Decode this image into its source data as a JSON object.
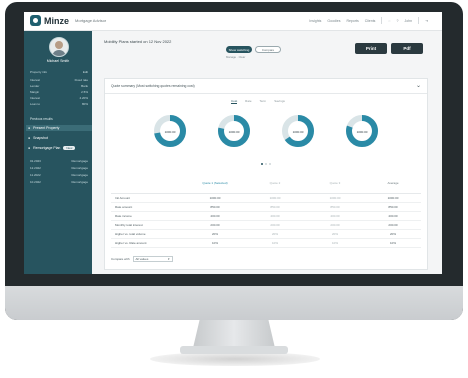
{
  "app": {
    "logo_text": "Minze",
    "logo_sub": "Mortgage Advisor",
    "nav": [
      "Insights",
      "Goodies",
      "Reports",
      "Clients",
      "John"
    ]
  },
  "sidebar": {
    "client_name": "Michael Smith",
    "section1_head": "Property info",
    "section1_value": "Edit",
    "details": [
      {
        "label": "Interest",
        "value": "Fixed rate"
      },
      {
        "label": "Lender",
        "value": "Bank"
      },
      {
        "label": "Margin",
        "value": "2.5%"
      },
      {
        "label": "Interest",
        "value": "4.20%"
      },
      {
        "label": "Loan to",
        "value": "80%"
      }
    ],
    "section2_head": "Previous results",
    "items": [
      {
        "label": "Present Property",
        "badge": ""
      },
      {
        "label": "Snapshot",
        "badge": ""
      },
      {
        "label": "Remortgage Plan",
        "badge": "New"
      }
    ],
    "history": [
      {
        "label": "01.2023",
        "value": "Remortgage"
      },
      {
        "label": "12.2022",
        "value": "Remortgage"
      },
      {
        "label": "11.2022",
        "value": "Remortgage"
      },
      {
        "label": "10.2022",
        "value": "Remortgage"
      }
    ]
  },
  "main": {
    "title": "Mobility Plans started on 12 Nov 2022",
    "pill_primary": "Show switching",
    "pill_secondary": "Compare",
    "subpill": "Manage · Clear",
    "print_label": "Print",
    "pdf_label": "Pdf",
    "card_title": "Quote summary (Most switching quotes remaining cost)",
    "tabs": [
      "Cost",
      "Rate",
      "Term",
      "Savings"
    ],
    "donuts": [
      {
        "amount": "1000.00",
        "fraction": 0.72
      },
      {
        "amount": "1000.00",
        "fraction": 0.78
      },
      {
        "amount": "1000.00",
        "fraction": 0.65
      },
      {
        "amount": "1000.00",
        "fraction": 0.8
      }
    ],
    "table": {
      "headers": [
        "",
        "Quote 1 (Selected)",
        "Quote 2",
        "Quote 3",
        "Average"
      ],
      "rows": [
        [
          "Init Amount",
          "1000.00",
          "1000.00",
          "1000.00",
          "1000.00"
        ],
        [
          "Rate amount",
          "850.00",
          "850.00",
          "850.00",
          "850.00"
        ],
        [
          "Rate income",
          "400.00",
          "400.00",
          "400.00",
          "400.00"
        ],
        [
          "Monthly total interest",
          "200.00",
          "200.00",
          "200.00",
          "200.00"
        ],
        [
          "Higher vs. total volume",
          "20%",
          "20%",
          "20%",
          "20%"
        ],
        [
          "Higher vs. Rate amount",
          "10%",
          "10%",
          "10%",
          "10%"
        ]
      ]
    },
    "compare_label": "Compare with",
    "compare_value": "All values"
  },
  "colors": {
    "sidebar": "#27545f",
    "accent": "#2a8aa6",
    "button": "#2b3a40"
  }
}
